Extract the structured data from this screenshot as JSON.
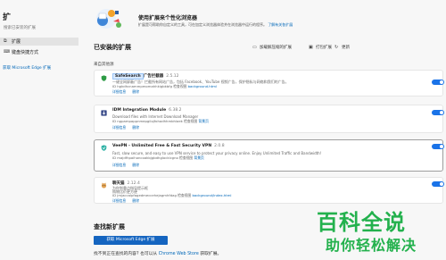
{
  "sidebar": {
    "title": "扩",
    "search_placeholder": "搜索已安装的扩展",
    "items": [
      {
        "label": "扩展",
        "icon": "puzzle-icon"
      },
      {
        "label": "键盘快捷方式",
        "icon": "keyboard-icon"
      }
    ],
    "store_link": "获取 Microsoft Edge 扩展"
  },
  "banner": {
    "title": "使用扩展来个性化浏览器",
    "text": "扩展是可帮助你自定义的工具，可在加定义浏览器体验并在浏览器中运行的程序。",
    "link": "了解有关各扩展"
  },
  "installed": {
    "title": "已安装的扩展",
    "load_unpacked": "加载解压缩的扩展",
    "pack": "打包扩展",
    "update": "更新",
    "from_other_sources": "来自其他源"
  },
  "extensions": [
    {
      "name": "SafeSearch",
      "name_suffix": "广告拦截器",
      "version": "2.5.12",
      "desc": "一键全网屏蔽广告！拦截所有网站广告，包括 Facebook、YouTube 视频广告，保护隐私与网络和我们的广告。",
      "id_label": "ID",
      "id": "hgkdhcnammpmomahhkigbkbfg",
      "inspect_label": "检查视图",
      "view_link": "background.html",
      "details": "详细信息",
      "remove": "删除",
      "enabled": true,
      "icon_color": "#2e9b46"
    },
    {
      "name": "IDM Integration Module",
      "version": "6.38.2",
      "desc": "Download files with Internet Download Manager",
      "id_label": "ID",
      "id": "ngpampappnmepgilojfohadhhmbhlaek",
      "inspect_label": "检查视图",
      "view_link": "背景页",
      "details": "详细信息",
      "remove": "删除",
      "enabled": true,
      "icon_color": "#3b4c8a"
    },
    {
      "name": "VeePN - Unlimited Free & Fast Security VPN",
      "version": "2.0.8",
      "desc": "Fast, slow secure, and easy to use VPN service to protect your privacy online. Enjoy Unlimited Traffic and Bandwidth!",
      "id_label": "ID",
      "id": "majdfhpaihoncoakbjgbdhglocklcgno",
      "inspect_label": "检查视图",
      "view_link": "背景页",
      "details": "详细信息",
      "remove": "删除",
      "enabled": true,
      "icon_color": "#2bb0a4"
    },
    {
      "name": "聊天猫",
      "version": "2.12.4",
      "desc": "为你划重点指导提示框",
      "desc2": "购物比价更方便",
      "id_label": "ID",
      "id": "jmjaccalpfagedmeccehejagmhfdag",
      "inspect_label": "检查视图",
      "view_link": "background/index.html",
      "details": "详细信息",
      "remove": "删除",
      "enabled": true,
      "icon_color": "#e0a050"
    }
  ],
  "find": {
    "title": "查找新扩展",
    "button": "获取 Microsoft Edge 扩展",
    "text_before": "找不到正在查找的内容? 也可以从",
    "link": "Chrome Web Store",
    "text_after": "获取扩展。"
  },
  "watermark": {
    "line1": "百科全说",
    "line2": "助你轻松解决",
    "color": "#23b14d"
  }
}
